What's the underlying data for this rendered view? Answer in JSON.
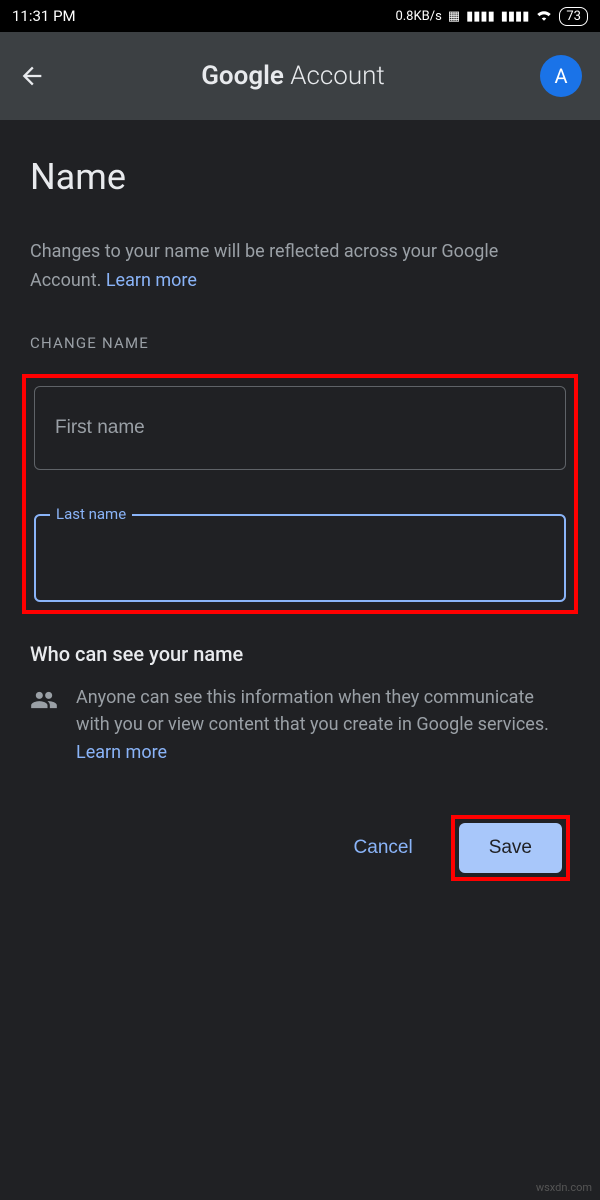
{
  "status": {
    "time": "11:31 PM",
    "data_rate": "0.8KB/s",
    "battery": "73"
  },
  "header": {
    "title_bold": "Google",
    "title_light": " Account",
    "avatar_letter": "A"
  },
  "page": {
    "title": "Name",
    "description": "Changes to your name will be reflected across your Google Account. ",
    "learn_more": "Learn more",
    "section_label": "CHANGE NAME"
  },
  "form": {
    "first_name_placeholder": "First name",
    "first_name_value": "",
    "last_name_label": "Last name",
    "last_name_value": ""
  },
  "visibility": {
    "title": "Who can see your name",
    "body": "Anyone can see this information when they communicate with you or view content that you create in Google services. ",
    "learn_more": "Learn more"
  },
  "buttons": {
    "cancel": "Cancel",
    "save": "Save"
  },
  "watermark": "wsxdn.com"
}
